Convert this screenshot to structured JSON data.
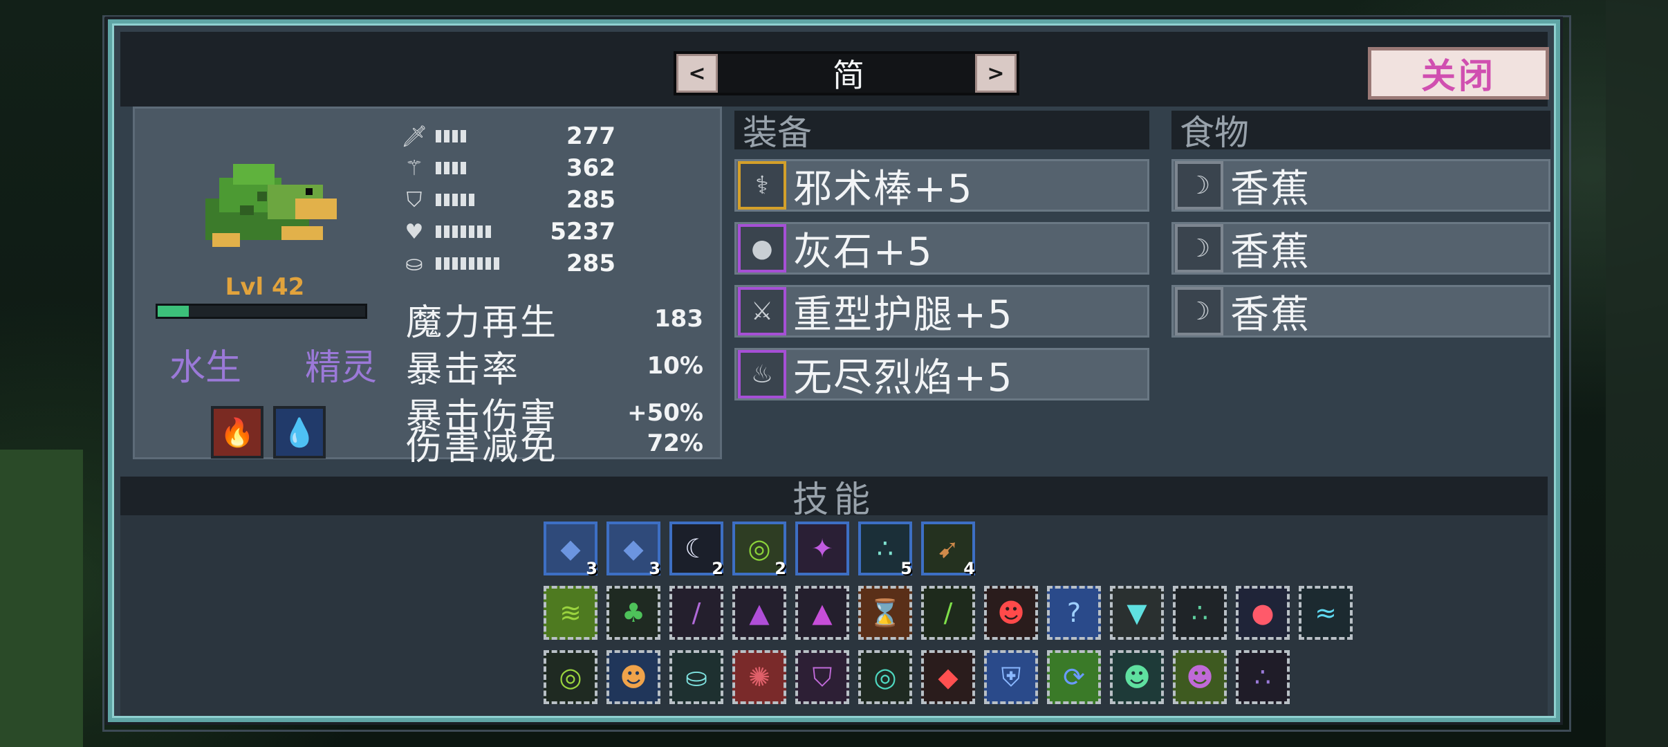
{
  "dialog": {
    "title": "简",
    "nav_prev": "<",
    "nav_next": ">",
    "close_label": "关闭"
  },
  "creature": {
    "level_text": "Lvl 42",
    "hp_fraction": 0.15,
    "type_tags": [
      "水生",
      "精灵"
    ],
    "elements": [
      {
        "name": "fire-boost",
        "icon": "🔥"
      },
      {
        "name": "water-shield",
        "icon": "💧"
      }
    ],
    "stats": [
      {
        "name": "attack",
        "icon": "🗡",
        "bars": 4,
        "value": "277"
      },
      {
        "name": "magic",
        "icon": "⚚",
        "bars": 4,
        "value": "362"
      },
      {
        "name": "defense",
        "icon": "⛉",
        "bars": 5,
        "value": "285"
      },
      {
        "name": "health",
        "icon": "♥",
        "bars": 7,
        "value": "5237"
      },
      {
        "name": "speed",
        "icon": "⛀",
        "bars": 8,
        "value": "285"
      }
    ],
    "attributes": [
      {
        "label": "魔力再生",
        "value": "183"
      },
      {
        "label": "暴击率",
        "value": "10%"
      },
      {
        "label": "暴击伤害",
        "value": "+50%"
      },
      {
        "label": "伤害减免",
        "value": "72%"
      }
    ]
  },
  "equipment": {
    "header": "装备",
    "items": [
      {
        "name": "邪术棒+5",
        "icon": "⚕",
        "border": "#d4a02a"
      },
      {
        "name": "灰石+5",
        "icon": "●",
        "border": "#a64fd6"
      },
      {
        "name": "重型护腿+5",
        "icon": "⚔",
        "border": "#a64fd6"
      },
      {
        "name": "无尽烈焰+5",
        "icon": "♨",
        "border": "#a64fd6"
      }
    ]
  },
  "food": {
    "header": "食物",
    "items": [
      {
        "name": "香蕉",
        "icon": "☽"
      },
      {
        "name": "香蕉",
        "icon": "☽"
      },
      {
        "name": "香蕉",
        "icon": "☽"
      }
    ]
  },
  "skills": {
    "header": "技能",
    "active": [
      {
        "icon": "◆",
        "count": "3",
        "color": "#6c95e0",
        "bg": "#2f4a7a"
      },
      {
        "icon": "◆",
        "count": "3",
        "color": "#6c95e0",
        "bg": "#2f4a7a"
      },
      {
        "icon": "☾",
        "count": "2",
        "color": "#e8ecff",
        "bg": "#1b1f2a"
      },
      {
        "icon": "◎",
        "count": "2",
        "color": "#8bd23a",
        "bg": "#2e3d23"
      },
      {
        "icon": "✦",
        "count": "",
        "color": "#c05be0",
        "bg": "#2a1f35"
      },
      {
        "icon": "∴",
        "count": "5",
        "color": "#7fe2d0",
        "bg": "#1b2f38"
      },
      {
        "icon": "➹",
        "count": "4",
        "color": "#d08a4a",
        "bg": "#24311f"
      }
    ],
    "passives_row1": [
      {
        "icon": "≋",
        "color": "#9ad33e",
        "bg": "#4e7a20"
      },
      {
        "icon": "♣",
        "color": "#4ec25a",
        "bg": "#1f2a22"
      },
      {
        "icon": "/",
        "color": "#b06ad8",
        "bg": "#241f2d"
      },
      {
        "icon": "▲",
        "color": "#b04ed8",
        "bg": "#241f2d"
      },
      {
        "icon": "▲",
        "color": "#c64ed8",
        "bg": "#241f2d"
      },
      {
        "icon": "⌛",
        "color": "#f0a34a",
        "bg": "#5a2f18"
      },
      {
        "icon": "/",
        "color": "#7fe04a",
        "bg": "#1e2a1c"
      },
      {
        "icon": "☻",
        "color": "#ff4a4a",
        "bg": "#2a1c1c"
      },
      {
        "icon": "?",
        "color": "#9fd0ff",
        "bg": "#2a4a8a"
      },
      {
        "icon": "▼",
        "color": "#5fe0e0",
        "bg": "#2a3030"
      },
      {
        "icon": "∴",
        "color": "#5fd0a0",
        "bg": "#1f2428"
      },
      {
        "icon": "●",
        "color": "#ff5a6a",
        "bg": "#1f2438"
      },
      {
        "icon": "≈",
        "color": "#5fd8f0",
        "bg": "#1c2a30"
      }
    ],
    "passives_row2": [
      {
        "icon": "◎",
        "color": "#9ad33e",
        "bg": "#1f2a22"
      },
      {
        "icon": "☻",
        "color": "#f0a34a",
        "bg": "#20365a"
      },
      {
        "icon": "⛀",
        "color": "#7fe2e0",
        "bg": "#1e3030"
      },
      {
        "icon": "✺",
        "color": "#e0606a",
        "bg": "#7a2a2a"
      },
      {
        "icon": "⛉",
        "color": "#c06ad8",
        "bg": "#2d1f35"
      },
      {
        "icon": "◎",
        "color": "#4ed8c0",
        "bg": "#1f2a22"
      },
      {
        "icon": "◆",
        "color": "#ff5050",
        "bg": "#2a1c1c"
      },
      {
        "icon": "⛨",
        "color": "#8ab8ff",
        "bg": "#2a4a8a"
      },
      {
        "icon": "⟳",
        "color": "#6a9aff",
        "bg": "#3a7a28"
      },
      {
        "icon": "☻",
        "color": "#5fe0a0",
        "bg": "#1e3a38"
      },
      {
        "icon": "☻",
        "color": "#c06ad8",
        "bg": "#3e5a20"
      },
      {
        "icon": "∴",
        "color": "#9a7ad8",
        "bg": "#1f1c28"
      }
    ]
  }
}
